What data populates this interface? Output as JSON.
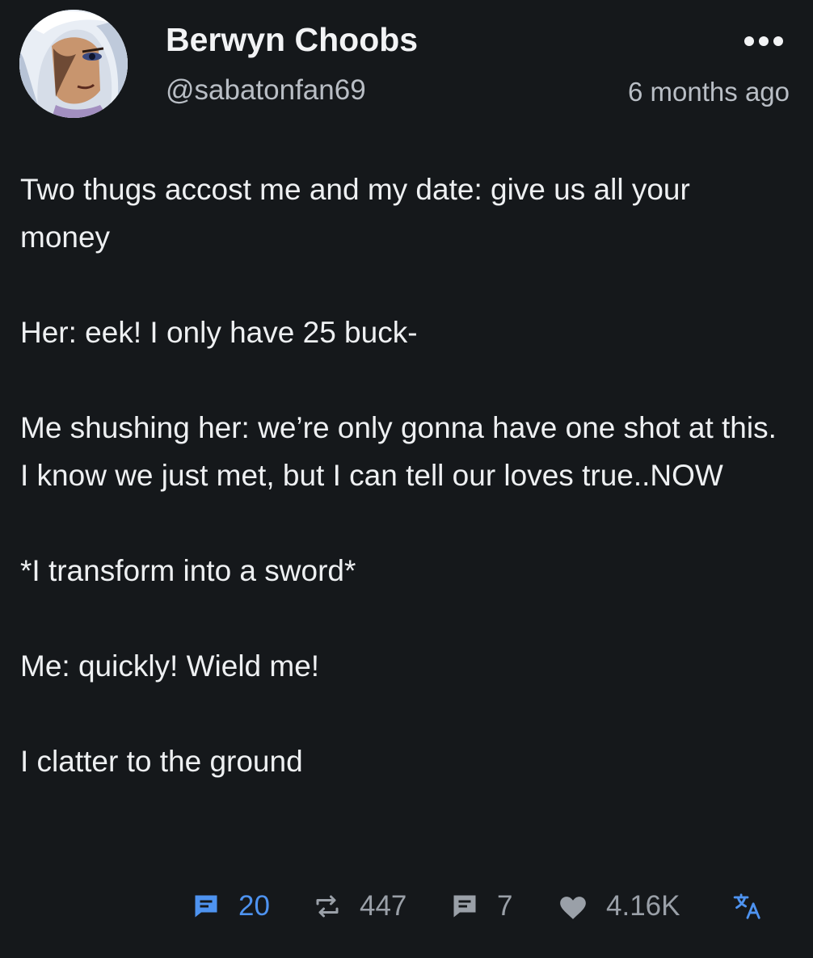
{
  "author": {
    "display_name": "Berwyn Choobs",
    "handle": "@sabatonfan69",
    "avatar_icon": "anime-character-avatar"
  },
  "timestamp": "6 months ago",
  "post": {
    "paragraphs": [
      "Two thugs accost me and my date: give  us all your money",
      "Her: eek! I only have 25 buck-",
      "Me shushing her: we’re only gonna have one shot at this. I know we just met, but I can tell our loves true..NOW",
      "*I transform into a sword*",
      "Me: quickly! Wield me!",
      "I clatter to the ground"
    ]
  },
  "actions": {
    "replies": {
      "icon": "reply-icon",
      "count": "20",
      "color": "#4e93f0"
    },
    "reposts": {
      "icon": "repost-icon",
      "count": "447"
    },
    "quotes": {
      "icon": "quote-icon",
      "count": "7"
    },
    "likes": {
      "icon": "heart-icon",
      "count": "4.16K"
    },
    "translate": {
      "icon": "translate-icon"
    }
  },
  "colors": {
    "background": "#15181b",
    "text": "#eef0f2",
    "muted": "#9aa0a8",
    "accent": "#4e93f0"
  }
}
